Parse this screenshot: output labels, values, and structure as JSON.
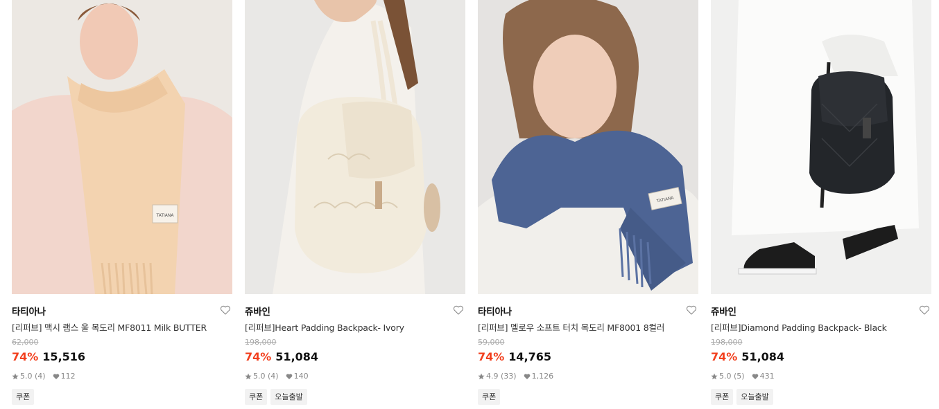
{
  "products": [
    {
      "brand": "타티아나",
      "name": "[리퍼브] 맥시 램스 울 목도리 MF8011 Milk BUTTER",
      "original_price": "62,000",
      "discount": "74%",
      "price": "15,516",
      "rating": "5.0 (4)",
      "likes": "112",
      "tags": [
        "쿠폰"
      ],
      "image_label": "TATIANA"
    },
    {
      "brand": "쥬바인",
      "name": "[리퍼브]Heart Padding Backpack- Ivory",
      "original_price": "198,000",
      "discount": "74%",
      "price": "51,084",
      "rating": "5.0 (4)",
      "likes": "140",
      "tags": [
        "쿠폰",
        "오늘출발"
      ],
      "image_label": ""
    },
    {
      "brand": "타티아나",
      "name": "[리퍼브] 멜로우 소프트 터치 목도리 MF8001 8컬러",
      "original_price": "59,000",
      "discount": "74%",
      "price": "14,765",
      "rating": "4.9 (33)",
      "likes": "1,126",
      "tags": [
        "쿠폰"
      ],
      "image_label": "TATIANA"
    },
    {
      "brand": "쥬바인",
      "name": "[리퍼브]Diamond Padding Backpack- Black",
      "original_price": "198,000",
      "discount": "74%",
      "price": "51,084",
      "rating": "5.0 (5)",
      "likes": "431",
      "tags": [
        "쿠폰",
        "오늘출발"
      ],
      "image_label": ""
    }
  ],
  "icons": {
    "wishlist": "heart-outline-icon",
    "rating": "star-icon",
    "likes": "heart-filled-icon"
  },
  "colors": {
    "discount": "#f2401f",
    "tag_bg": "#f2f2f2"
  }
}
